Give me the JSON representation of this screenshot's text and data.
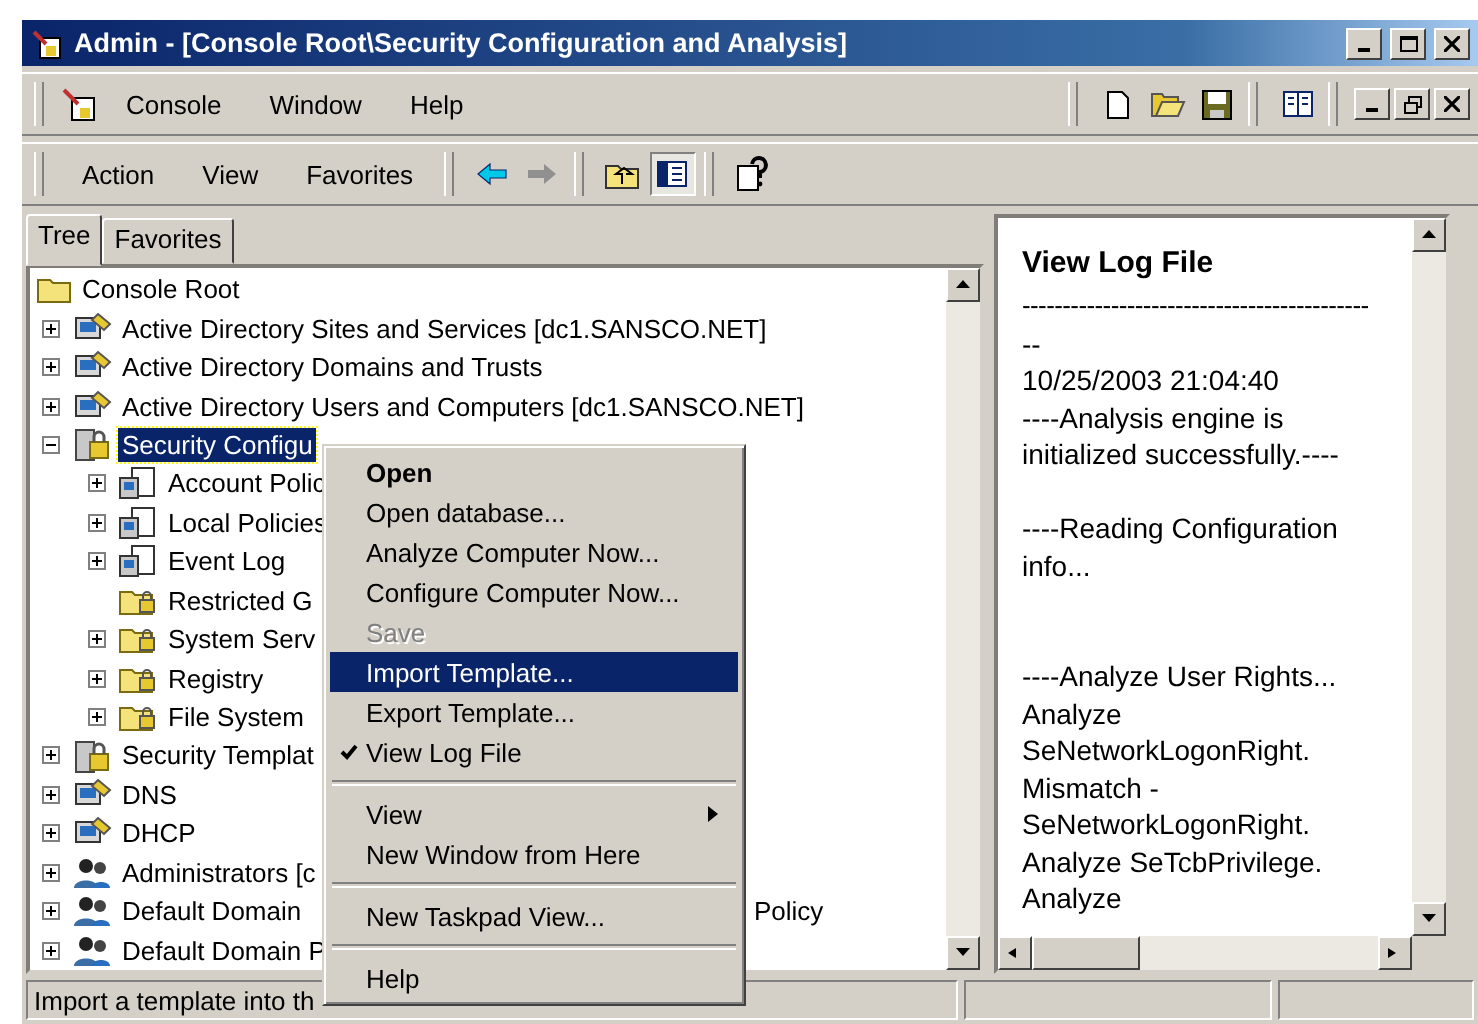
{
  "window": {
    "title": "Admin - [Console Root\\Security Configuration and Analysis]"
  },
  "menu_bar": [
    "Console",
    "Window",
    "Help"
  ],
  "action_bar": [
    "Action",
    "View",
    "Favorites"
  ],
  "toolbar": [
    {
      "kind": "back",
      "disabled": false
    },
    {
      "kind": "forward",
      "disabled": true
    },
    {
      "kind": "up",
      "pressed": false
    },
    {
      "kind": "tree-toggle",
      "pressed": true
    },
    {
      "kind": "help",
      "pressed": false
    }
  ],
  "tabs": [
    {
      "label": "Tree",
      "selected": true
    },
    {
      "label": "Favorites",
      "selected": false
    }
  ],
  "tree": [
    {
      "label": "Console Root",
      "kind": "root",
      "selected": false,
      "children": [
        {
          "label": "Active Directory Sites and Services [dc1.SANSCO.NET]",
          "kind": "tool",
          "selected": false,
          "expanded": false
        },
        {
          "label": "Active Directory Domains and Trusts",
          "kind": "tool",
          "selected": false,
          "expanded": false
        },
        {
          "label": "Active Directory Users and Computers [dc1.SANSCO.NET]",
          "kind": "tool",
          "selected": false,
          "expanded": false
        },
        {
          "label": "Security Configu",
          "kind": "lock",
          "selected": true,
          "expanded": true,
          "children": [
            {
              "label": "Account Polic",
              "kind": "doc",
              "selected": false,
              "expanded": false
            },
            {
              "label": "Local Policies",
              "kind": "doc",
              "selected": false,
              "expanded": false
            },
            {
              "label": "Event Log",
              "kind": "doc",
              "selected": false,
              "expanded": false
            },
            {
              "label": "Restricted G",
              "kind": "lockfolder",
              "selected": false
            },
            {
              "label": "System Serv",
              "kind": "lockfolder",
              "selected": false,
              "expanded": false
            },
            {
              "label": "Registry",
              "kind": "lockfolder",
              "selected": false,
              "expanded": false
            },
            {
              "label": "File System",
              "kind": "lockfolder",
              "selected": false,
              "expanded": false
            }
          ]
        },
        {
          "label": "Security Templat",
          "kind": "lock",
          "selected": false,
          "expanded": false
        },
        {
          "label": "DNS",
          "kind": "tool",
          "selected": false,
          "expanded": false
        },
        {
          "label": "DHCP",
          "kind": "tool",
          "selected": false,
          "expanded": false
        },
        {
          "label": "Administrators [c",
          "kind": "people",
          "selected": false,
          "expanded": false
        },
        {
          "label": "Default Domain",
          "kind": "people",
          "selected": false,
          "expanded": false,
          "text_right": "Policy"
        },
        {
          "label": "Default Domain P",
          "kind": "people",
          "selected": false,
          "expanded": false
        }
      ]
    }
  ],
  "context_menu": [
    {
      "kind": "item",
      "label": "Open",
      "default": true,
      "selected": false,
      "disabled": false,
      "checked": false
    },
    {
      "kind": "item",
      "label": "Open database...",
      "default": false,
      "selected": false,
      "disabled": false,
      "checked": false
    },
    {
      "kind": "item",
      "label": "Analyze Computer Now...",
      "default": false,
      "selected": false,
      "disabled": false,
      "checked": false
    },
    {
      "kind": "item",
      "label": "Configure Computer Now...",
      "default": false,
      "selected": false,
      "disabled": false,
      "checked": false
    },
    {
      "kind": "item",
      "label": "Save",
      "default": false,
      "selected": false,
      "disabled": true,
      "checked": false
    },
    {
      "kind": "item",
      "label": "Import Template...",
      "default": false,
      "selected": true,
      "disabled": false,
      "checked": false
    },
    {
      "kind": "item",
      "label": "Export Template...",
      "default": false,
      "selected": false,
      "disabled": false,
      "checked": false
    },
    {
      "kind": "item",
      "label": "View Log File",
      "default": false,
      "selected": false,
      "disabled": false,
      "checked": true
    },
    {
      "kind": "separator"
    },
    {
      "kind": "item",
      "label": "View",
      "default": false,
      "selected": false,
      "disabled": false,
      "checked": false,
      "submenu": true
    },
    {
      "kind": "item",
      "label": "New Window from Here",
      "default": false,
      "selected": false,
      "disabled": false,
      "checked": false
    },
    {
      "kind": "separator"
    },
    {
      "kind": "item",
      "label": "New Taskpad View...",
      "default": false,
      "selected": false,
      "disabled": false,
      "checked": false
    },
    {
      "kind": "separator"
    },
    {
      "kind": "item",
      "label": "Help",
      "default": false,
      "selected": false,
      "disabled": false,
      "checked": false
    }
  ],
  "log_pane": {
    "title": "View Log File",
    "lines": [
      {
        "kind": "text",
        "text": "-------------------------------------------"
      },
      {
        "kind": "text",
        "text": "--"
      },
      {
        "kind": "text",
        "text": "10/25/2003 21:04:40"
      },
      {
        "kind": "text",
        "text": "----Analysis engine is"
      },
      {
        "kind": "text",
        "text": "initialized successfully.----"
      },
      {
        "kind": "blank"
      },
      {
        "kind": "text",
        "text": "----Reading Configuration"
      },
      {
        "kind": "text",
        "text": "info..."
      },
      {
        "kind": "blank"
      },
      {
        "kind": "blank"
      },
      {
        "kind": "text",
        "text": "----Analyze User Rights..."
      },
      {
        "kind": "text",
        "text": "Analyze"
      },
      {
        "kind": "text",
        "text": "SeNetworkLogonRight."
      },
      {
        "kind": "text",
        "text": "Mismatch -"
      },
      {
        "kind": "text",
        "text": "SeNetworkLogonRight."
      },
      {
        "kind": "text",
        "text": "Analyze SeTcbPrivilege."
      },
      {
        "kind": "text",
        "text": "Analyze"
      }
    ]
  },
  "status_bar": {
    "text": "Import a template into th"
  }
}
